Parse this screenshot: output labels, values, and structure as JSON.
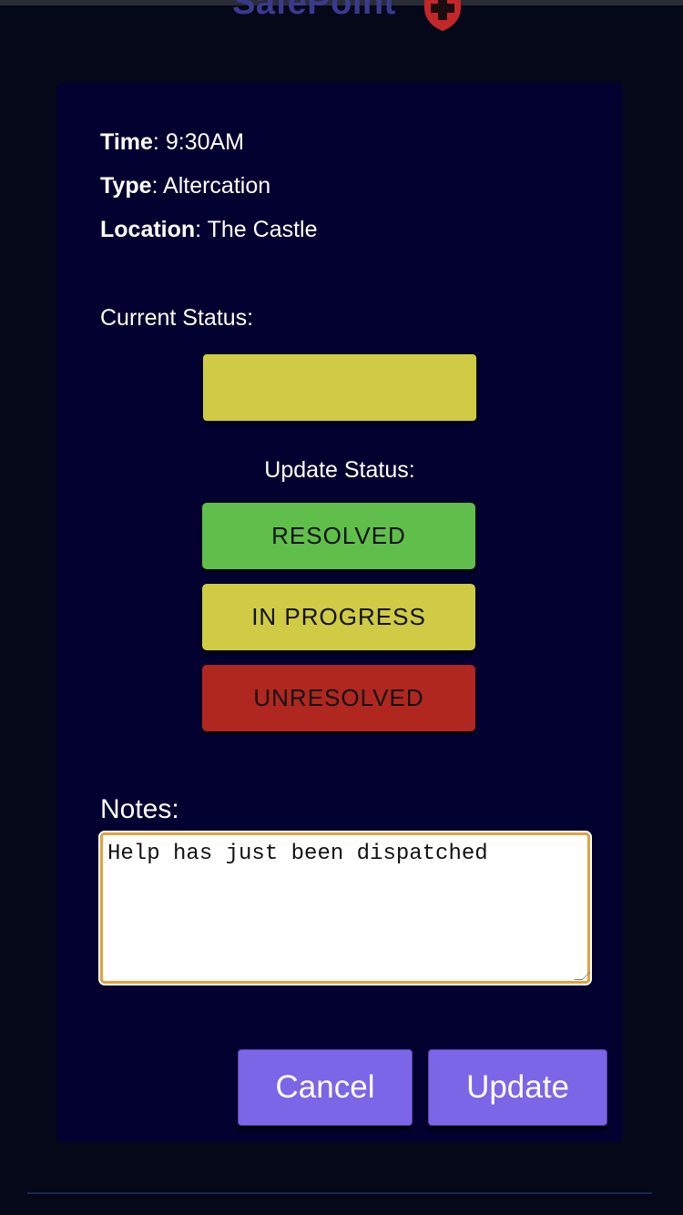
{
  "brand": {
    "name": "SafePoint",
    "logo_icon": "shield-cross-icon",
    "colors": {
      "name": "#3b3a8e",
      "logo": "#c4272a"
    }
  },
  "incident": {
    "time_label": "Time",
    "time_value": "9:30AM",
    "type_label": "Type",
    "type_value": "Altercation",
    "location_label": "Location",
    "location_value": "The Castle"
  },
  "status": {
    "current_label": "Current Status:",
    "current_color": "#cfcb44",
    "update_label": "Update Status:",
    "options": [
      {
        "label": "RESOLVED",
        "color": "#5fbf4a"
      },
      {
        "label": "IN PROGRESS",
        "color": "#cfcb44"
      },
      {
        "label": "UNRESOLVED",
        "color": "#b0271f"
      }
    ]
  },
  "notes": {
    "label": "Notes:",
    "value": "Help has just been dispatched"
  },
  "actions": {
    "cancel_label": "Cancel",
    "update_label": "Update",
    "color": "#7a66e6"
  }
}
